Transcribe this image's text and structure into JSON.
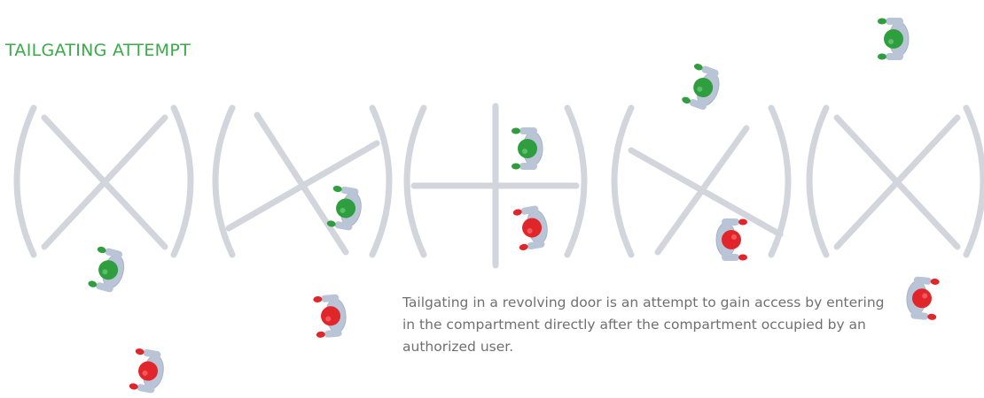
{
  "title": "TAILGATING ATTEMPT",
  "caption": "Tailgating in a revolving door is an attempt to gain access by entering in the compartment directly after the compartment occupied by an authorized user.",
  "colors": {
    "title": "#3aaa4a",
    "authorized_person": "#2f9e3f",
    "tailgater_person": "#e0262b",
    "body": "#b9c4d6",
    "door_frame": "#d2d6dc",
    "caption_text": "#707070"
  },
  "legend_semantics": {
    "green_person": "authorized-user",
    "red_person": "tailgater"
  }
}
